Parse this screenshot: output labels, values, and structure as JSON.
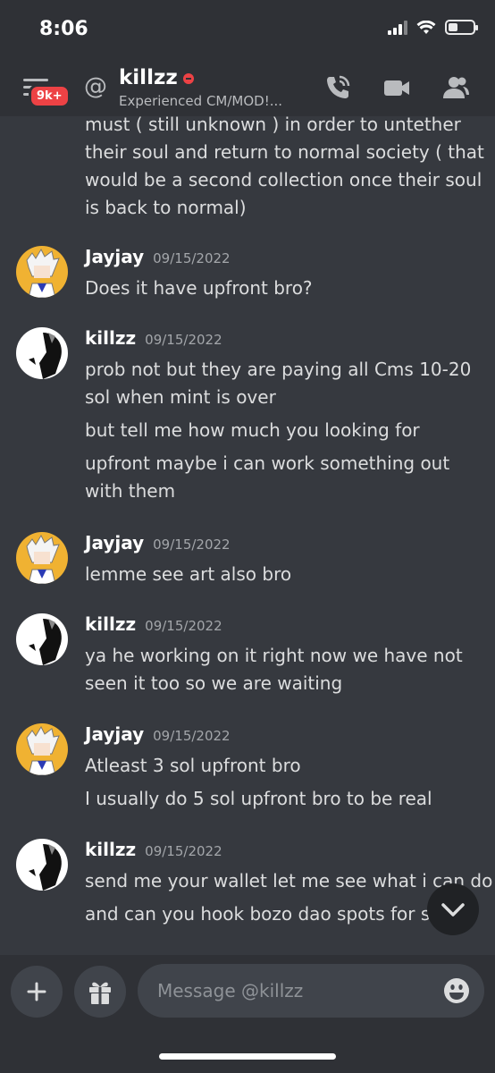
{
  "status_bar": {
    "time": "8:06"
  },
  "header": {
    "badge": "9k+",
    "at_symbol": "@",
    "name": "killzz",
    "subtitle": "Experienced CM/MOD!..."
  },
  "top_fragment": [
    "must ( still unknown ) in order to untether",
    "their soul and return to normal society ( that",
    "would be a second collection once their soul",
    "is back to normal)"
  ],
  "groups": [
    {
      "author": "Jayjay",
      "time": "09/15/2022",
      "lines": [
        "Does it have upfront bro?"
      ]
    },
    {
      "author": "killzz",
      "time": "09/15/2022",
      "lines": [
        "prob not but they are paying all Cms 10-20",
        "sol when mint is over",
        "but tell me how much you looking for",
        "upfront maybe i can work something out",
        "with them"
      ]
    },
    {
      "author": "Jayjay",
      "time": "09/15/2022",
      "lines": [
        "lemme see art also bro"
      ]
    },
    {
      "author": "killzz",
      "time": "09/15/2022",
      "lines": [
        "ya he working on it right now we have not",
        "seen it too so we are waiting"
      ]
    },
    {
      "author": "Jayjay",
      "time": "09/15/2022",
      "lines": [
        "Atleast 3 sol upfront bro",
        "I usually do 5 sol upfront bro to be real"
      ]
    },
    {
      "author": "killzz",
      "time": "09/15/2022",
      "lines": [
        "send me your wallet let me see what i can do",
        "and can you hook bozo dao spots for sp"
      ]
    }
  ],
  "composer": {
    "plus": "+",
    "placeholder": "Message @killzz"
  },
  "colors": {
    "background": "#36393f",
    "header": "#2f3136",
    "badge": "#ed4245",
    "accent_avatar": "#f0b232"
  },
  "icons": [
    "menu-icon",
    "at-icon",
    "dnd-status-icon",
    "phone-icon",
    "video-icon",
    "members-icon",
    "chevron-down-icon",
    "plus-icon",
    "gift-icon",
    "emoji-icon"
  ]
}
